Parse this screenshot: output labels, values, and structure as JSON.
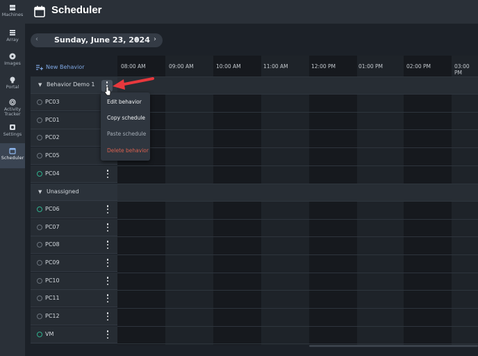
{
  "sidebar": {
    "items": [
      {
        "label": "Machines",
        "icon": "machines-icon"
      },
      {
        "label": "Array",
        "icon": "array-icon"
      },
      {
        "label": "Images",
        "icon": "images-icon"
      },
      {
        "label": "Portal",
        "icon": "portal-icon"
      },
      {
        "label": "Activity Tracker",
        "icon": "activity-icon"
      },
      {
        "label": "Settings",
        "icon": "settings-icon"
      },
      {
        "label": "Scheduler",
        "icon": "scheduler-icon",
        "active": true
      }
    ]
  },
  "header": {
    "title": "Scheduler"
  },
  "date_nav": {
    "prev": "‹",
    "date": "Sunday, June 23, 2024",
    "caret": "▼",
    "next": "›"
  },
  "new_behavior": "New Behavior",
  "times": [
    "08:00 AM",
    "09:00 AM",
    "10:00 AM",
    "11:00 AM",
    "12:00 PM",
    "01:00 PM",
    "02:00 PM",
    "03:00 PM"
  ],
  "groups": [
    {
      "name": "Behavior Demo 1",
      "machines": [
        {
          "name": "PC03",
          "on": false
        },
        {
          "name": "PC01",
          "on": false
        },
        {
          "name": "PC02",
          "on": false
        },
        {
          "name": "PC05",
          "on": false
        },
        {
          "name": "PC04",
          "on": true
        }
      ]
    },
    {
      "name": "Unassigned",
      "machines": [
        {
          "name": "PC06",
          "on": true
        },
        {
          "name": "PC07",
          "on": false
        },
        {
          "name": "PC08",
          "on": false
        },
        {
          "name": "PC09",
          "on": false
        },
        {
          "name": "PC10",
          "on": false
        },
        {
          "name": "PC11",
          "on": false
        },
        {
          "name": "PC12",
          "on": false
        },
        {
          "name": "VM",
          "on": true
        }
      ]
    }
  ],
  "context_menu": {
    "items": [
      {
        "label": "Edit behavior",
        "style": "normal"
      },
      {
        "label": "Copy schedule",
        "style": "normal"
      },
      {
        "label": "Paste schedule",
        "style": "muted"
      },
      {
        "label": "Delete behavior",
        "style": "danger"
      }
    ]
  },
  "colors": {
    "accent": "#7fa8e4",
    "online": "#2fb18e",
    "danger": "#d9604f",
    "annotation_arrow": "#e8383d"
  }
}
